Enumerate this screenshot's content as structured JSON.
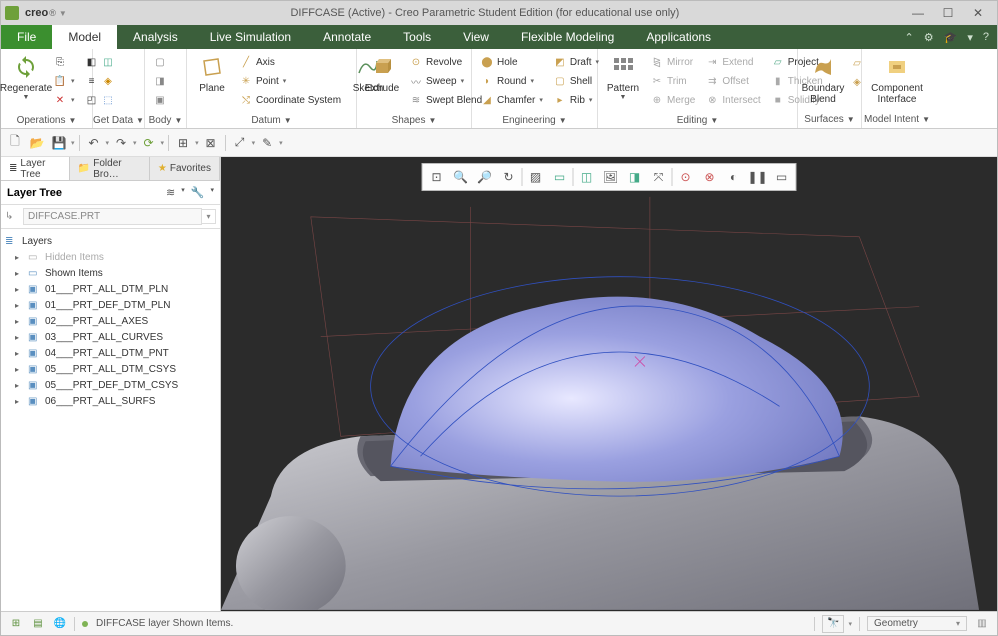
{
  "titlebar": {
    "brand": "creo",
    "title": "DIFFCASE (Active) - Creo Parametric Student Edition (for educational use only)"
  },
  "menu": {
    "file": "File",
    "tabs": [
      "Model",
      "Analysis",
      "Live Simulation",
      "Annotate",
      "Tools",
      "View",
      "Flexible Modeling",
      "Applications"
    ],
    "active": "Model"
  },
  "ribbon": {
    "groups": {
      "operations": {
        "label": "Operations",
        "regenerate": "Regenerate"
      },
      "getdata": {
        "label": "Get Data"
      },
      "body": {
        "label": "Body"
      },
      "datum": {
        "label": "Datum",
        "plane": "Plane",
        "axis": "Axis",
        "point": "Point",
        "csys": "Coordinate System",
        "sketch": "Sketch"
      },
      "shapes": {
        "label": "Shapes",
        "extrude": "Extrude",
        "revolve": "Revolve",
        "sweep": "Sweep",
        "swept_blend": "Swept Blend"
      },
      "engineering": {
        "label": "Engineering",
        "hole": "Hole",
        "round": "Round",
        "chamfer": "Chamfer",
        "draft": "Draft",
        "shell": "Shell",
        "rib": "Rib"
      },
      "editing": {
        "label": "Editing",
        "pattern": "Pattern",
        "mirror": "Mirror",
        "trim": "Trim",
        "merge": "Merge",
        "extend": "Extend",
        "offset": "Offset",
        "intersect": "Intersect",
        "project": "Project",
        "thicken": "Thicken",
        "solidify": "Solidify"
      },
      "surfaces": {
        "label": "Surfaces",
        "boundary_blend": "Boundary Blend"
      },
      "modelintent": {
        "label": "Model Intent",
        "component_interface": "Component Interface"
      }
    }
  },
  "sidebar": {
    "tabs": {
      "layer_tree": "Layer Tree",
      "folder_browser": "Folder Bro…",
      "favorites": "Favorites"
    },
    "header": "Layer Tree",
    "filter_value": "DIFFCASE.PRT",
    "root": "Layers",
    "hidden_items": "Hidden Items",
    "shown_items": "Shown Items",
    "items": [
      "01___PRT_ALL_DTM_PLN",
      "01___PRT_DEF_DTM_PLN",
      "02___PRT_ALL_AXES",
      "03___PRT_ALL_CURVES",
      "04___PRT_ALL_DTM_PNT",
      "05___PRT_ALL_DTM_CSYS",
      "05___PRT_DEF_DTM_CSYS",
      "06___PRT_ALL_SURFS"
    ]
  },
  "status": {
    "message": "DIFFCASE layer Shown Items.",
    "filter": "Geometry"
  }
}
